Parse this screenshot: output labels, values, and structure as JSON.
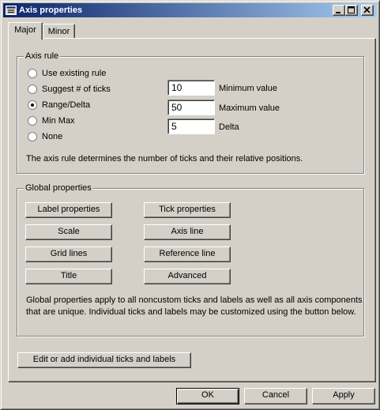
{
  "window": {
    "title": "Axis properties",
    "icon": "window-app-icon",
    "caption_buttons": [
      "minimize-icon",
      "maximize-icon",
      "close-icon"
    ]
  },
  "tabs": [
    {
      "label": "Major",
      "active": true
    },
    {
      "label": "Minor",
      "active": false
    }
  ],
  "axis_rule": {
    "title": "Axis rule",
    "options": [
      {
        "label": "Use existing rule",
        "checked": false
      },
      {
        "label": "Suggest # of ticks",
        "checked": false
      },
      {
        "label": "Range/Delta",
        "checked": true
      },
      {
        "label": "Min Max",
        "checked": false
      },
      {
        "label": "None",
        "checked": false
      }
    ],
    "fields": [
      {
        "value": "10",
        "label": "Minimum value"
      },
      {
        "value": "50",
        "label": "Maximum value"
      },
      {
        "value": "5",
        "label": "Delta"
      }
    ],
    "description": "The axis rule determines the number of ticks and their relative positions."
  },
  "global_properties": {
    "title": "Global properties",
    "buttons_left": [
      "Label properties",
      "Scale",
      "Grid lines",
      "Title"
    ],
    "buttons_right": [
      "Tick properties",
      "Axis line",
      "Reference line",
      "Advanced"
    ],
    "description_line1": "Global properties apply to all noncustom ticks and labels as well as all axis components",
    "description_line2": "that are unique. Individual ticks and labels may be customized using the button below."
  },
  "edit_button": "Edit or add individual ticks and labels",
  "footer": {
    "ok": "OK",
    "cancel": "Cancel",
    "apply": "Apply"
  }
}
